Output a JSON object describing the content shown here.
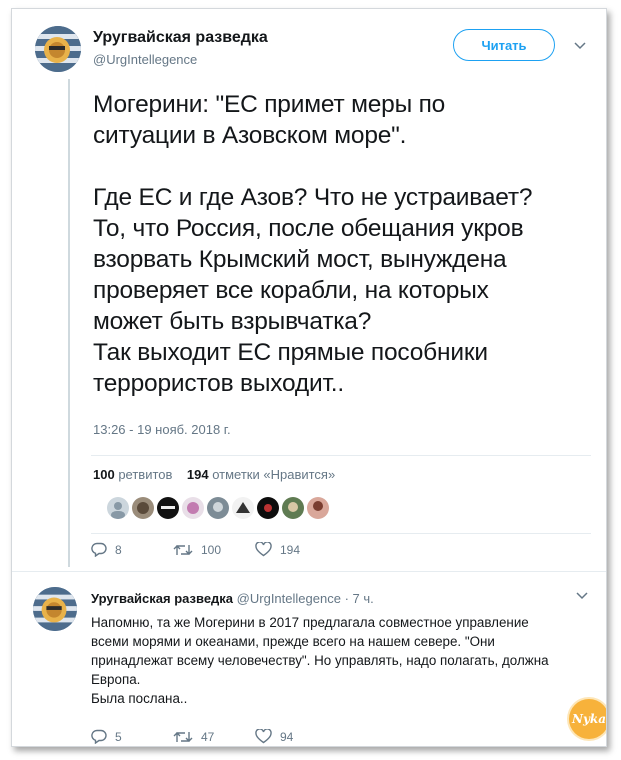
{
  "tweet": {
    "author_name": "Уругвайская разведка",
    "author_handle": "@UrgIntellegence",
    "follow_label": "Читать",
    "text": "Могерини: \"ЕС примет меры по\nситуации в Азовском море\".\n\nГде ЕС и где Азов? Что не устраивает?\nТо, что Россия, после обещания укров\nвзорвать Крымский мост, вынуждена\nпроверяет все корабли, на которых\nможет быть взрывчатка?\nТак выходит ЕС прямые пособники\nтеррористов выходит..",
    "timestamp": "13:26 - 19 нояб. 2018 г.",
    "retweets_count": "100",
    "retweets_label": "ретвитов",
    "likes_count": "194",
    "likes_label": "отметки «Нравится»",
    "liker_count": 9,
    "actions": {
      "replies": "8",
      "retweets": "100",
      "likes": "194"
    }
  },
  "reply": {
    "author_name": "Уругвайская разведка",
    "author_handle": "@UrgIntellegence",
    "time": "· 7 ч.",
    "text": "Напомню, та же Могерини в 2017 предлагала совместное управление\nвсеми морями и океанами, прежде всего на нашем севере. \"Они\nпринадлежат всему человечеству\". Но управлять, надо полагать, должна\nЕвропа.\nБыла послана..",
    "actions": {
      "replies": "5",
      "retweets": "47",
      "likes": "94"
    }
  },
  "watermark": "Nyka",
  "colors": {
    "accent": "#1da1f2",
    "muted": "#657786",
    "text": "#14171a"
  },
  "icons": {
    "reply": "reply-icon",
    "retweet": "retweet-icon",
    "like": "heart-icon",
    "caret": "chevron-down-icon"
  }
}
